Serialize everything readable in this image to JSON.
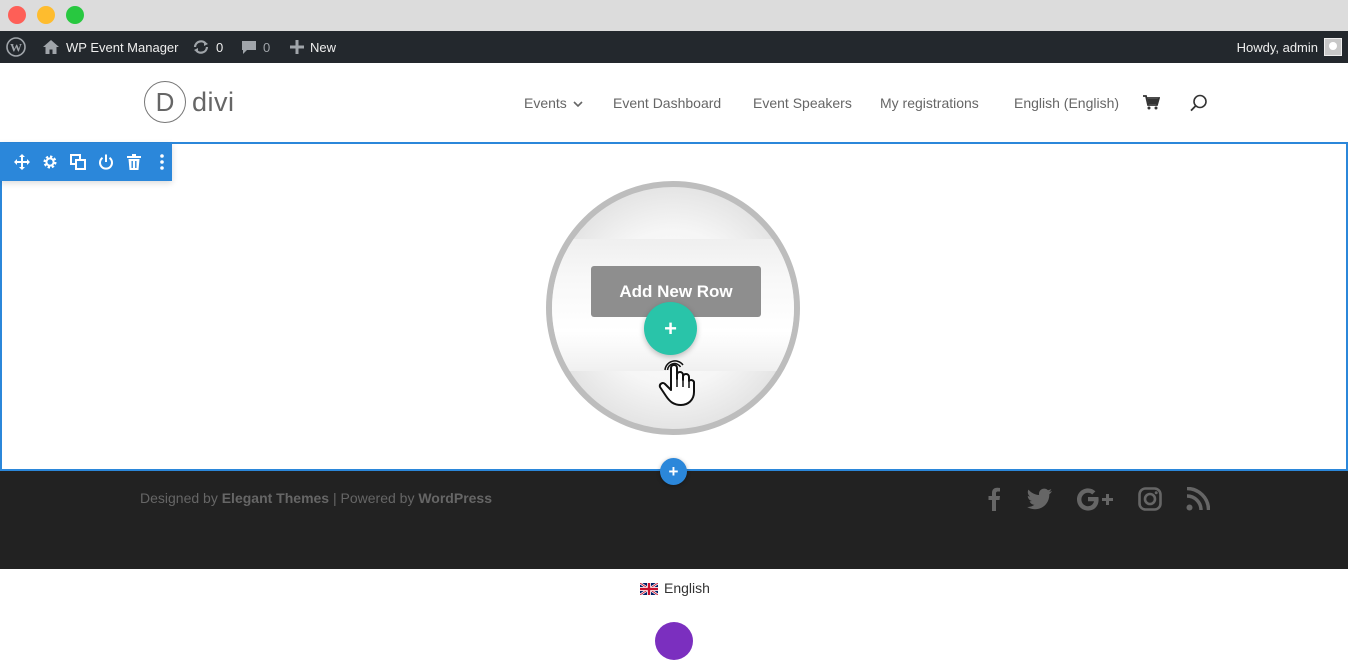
{
  "admin_bar": {
    "site_name": "WP Event Manager",
    "updates_count": "0",
    "comments_count": "0",
    "new_label": "New",
    "greeting": "Howdy, admin"
  },
  "header": {
    "logo_letter": "D",
    "logo_text": "divi",
    "nav": [
      {
        "label": "Events"
      },
      {
        "label": "Event Dashboard"
      },
      {
        "label": "Event Speakers"
      },
      {
        "label": "My registrations"
      },
      {
        "label": "English (English)"
      }
    ]
  },
  "builder": {
    "add_row_label": "Add New Row",
    "plus_symbol": "+"
  },
  "footer": {
    "credits_prefix": "Designed by",
    "credits_brand": "Elegant Themes",
    "credits_mid": "| Powered by",
    "credits_wp": "WordPress",
    "social_icons": [
      "facebook-icon",
      "twitter-icon",
      "google-plus-icon",
      "instagram-icon",
      "rss-icon"
    ]
  },
  "language_switcher": {
    "label": "English"
  },
  "colors": {
    "accent_blue": "#2b87da",
    "add_green": "#29c4a9",
    "admin_bar": "#23282d",
    "footer_bg": "#222222"
  }
}
